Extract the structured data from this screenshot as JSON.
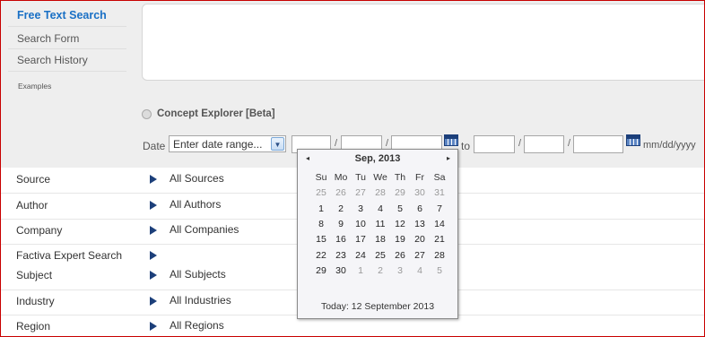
{
  "nav": {
    "items": [
      {
        "label": "Free Text Search",
        "active": true
      },
      {
        "label": "Search Form",
        "active": false
      },
      {
        "label": "Search History",
        "active": false
      }
    ],
    "examples_label": "Examples"
  },
  "search": {
    "concept_label": "Concept Explorer [Beta]",
    "date_label": "Date",
    "date_select_value": "Enter date range...",
    "to_label": "to",
    "separator": "/",
    "format_hint": "mm/dd/yyyy"
  },
  "filters": [
    {
      "label": "Source",
      "value": "All Sources"
    },
    {
      "label": "Author",
      "value": "All Authors"
    },
    {
      "label": "Company",
      "value": "All Companies"
    },
    {
      "label": "Factiva Expert Search",
      "value": ""
    },
    {
      "label": "Subject",
      "value": "All Subjects"
    },
    {
      "label": "Industry",
      "value": "All Industries"
    },
    {
      "label": "Region",
      "value": "All Regions"
    }
  ],
  "calendar": {
    "month_label": "Sep, 2013",
    "prev_icon": "◂",
    "next_icon": "▸",
    "weekdays": [
      "Su",
      "Mo",
      "Tu",
      "We",
      "Th",
      "Fr",
      "Sa"
    ],
    "weeks": [
      [
        "25",
        "26",
        "27",
        "28",
        "29",
        "30",
        "31"
      ],
      [
        "1",
        "2",
        "3",
        "4",
        "5",
        "6",
        "7"
      ],
      [
        "8",
        "9",
        "10",
        "11",
        "12",
        "13",
        "14"
      ],
      [
        "15",
        "16",
        "17",
        "18",
        "19",
        "20",
        "21"
      ],
      [
        "22",
        "23",
        "24",
        "25",
        "26",
        "27",
        "28"
      ],
      [
        "29",
        "30",
        "1",
        "2",
        "3",
        "4",
        "5"
      ]
    ],
    "other_month": [
      [
        true,
        true,
        true,
        true,
        true,
        true,
        true
      ],
      [
        false,
        false,
        false,
        false,
        false,
        false,
        false
      ],
      [
        false,
        false,
        false,
        false,
        false,
        false,
        false
      ],
      [
        false,
        false,
        false,
        false,
        false,
        false,
        false
      ],
      [
        false,
        false,
        false,
        false,
        false,
        false,
        false
      ],
      [
        false,
        false,
        true,
        true,
        true,
        true,
        true
      ]
    ],
    "today_label": "Today: 12 September 2013"
  },
  "colors": {
    "accent": "#1a70c5",
    "frame": "#c80000",
    "arrow": "#1c3f7a"
  }
}
